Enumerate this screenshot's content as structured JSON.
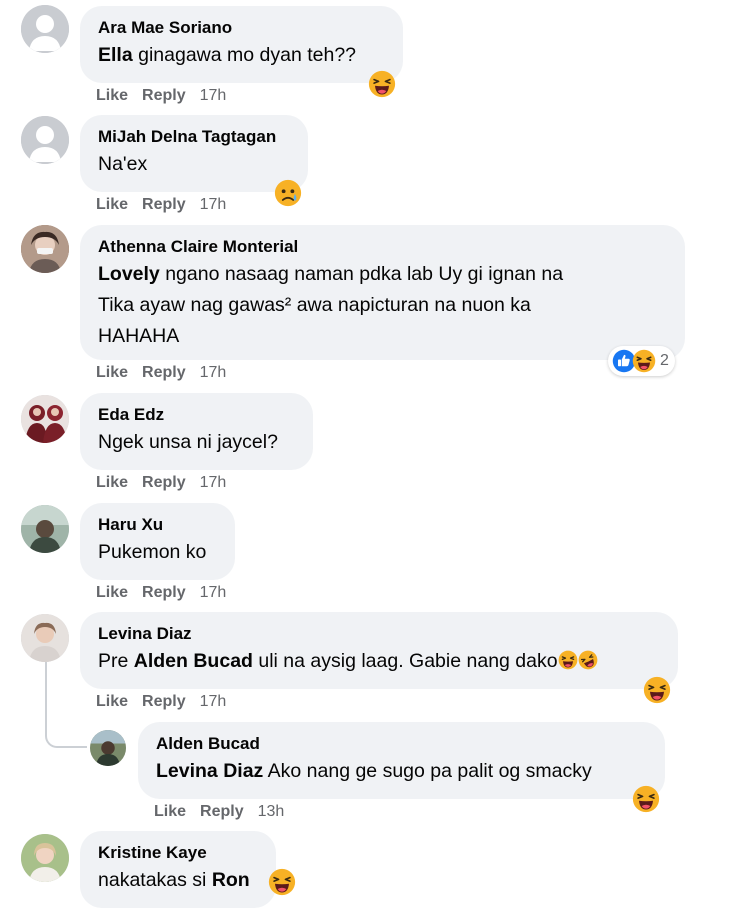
{
  "comments": [
    {
      "author": "Ara Mae Soriano",
      "mention": "Ella",
      "text": " ginagawa mo dyan teh??",
      "actions": {
        "like": "Like",
        "reply": "Reply",
        "time": "17h"
      },
      "reaction_icon": "laughing-face-icon"
    },
    {
      "author": "MiJah Delna Tagtagan",
      "text": "Na'ex",
      "actions": {
        "like": "Like",
        "reply": "Reply",
        "time": "17h"
      },
      "reaction_icon": "crying-face-icon"
    },
    {
      "author": "Athenna Claire Monterial",
      "mention": "Lovely",
      "text_line1": " ngano nasaag naman pdka lab Uy gi ignan na",
      "text_line2": "Tika ayaw nag gawas² awa napicturan na nuon ka",
      "text_line3": "HAHAHA",
      "actions": {
        "like": "Like",
        "reply": "Reply",
        "time": "17h"
      },
      "reactions": {
        "icons": [
          "like-icon",
          "haha-icon"
        ],
        "count": "2"
      }
    },
    {
      "author": "Eda Edz",
      "text": "Ngek unsa ni jaycel?",
      "actions": {
        "like": "Like",
        "reply": "Reply",
        "time": "17h"
      }
    },
    {
      "author": "Haru Xu",
      "text": "Pukemon ko",
      "actions": {
        "like": "Like",
        "reply": "Reply",
        "time": "17h"
      }
    },
    {
      "author": "Levina Diaz",
      "text_prefix": "Pre ",
      "mention": "Alden Bucad",
      "text": " uli na aysig laag. Gabie nang dako",
      "actions": {
        "like": "Like",
        "reply": "Reply",
        "time": "17h"
      },
      "reaction_icon": "laughing-face-icon"
    },
    {
      "author": "Alden Bucad",
      "mention": "Levina Diaz",
      "text": " Ako nang ge sugo pa palit og smacky",
      "actions": {
        "like": "Like",
        "reply": "Reply",
        "time": "13h"
      },
      "reaction_icon": "laughing-face-icon"
    },
    {
      "author": "Kristine Kaye",
      "text": "nakatakas si ",
      "mention": "Ron",
      "reaction_icon": "laughing-face-icon"
    }
  ],
  "colors": {
    "bubble": "#f0f2f5",
    "action_text": "#65676b",
    "like_blue": "#1877f2",
    "emoji_yellow": "#f7b125"
  }
}
